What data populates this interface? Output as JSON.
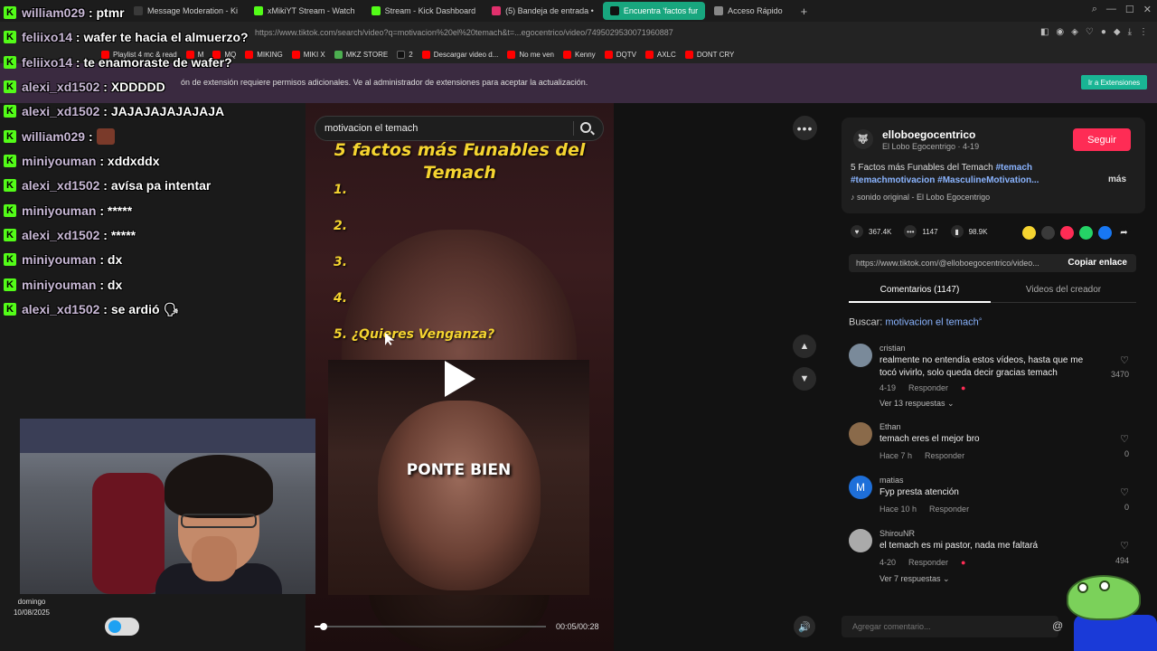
{
  "browser": {
    "tabs": [
      {
        "label": "Message Moderation - Ki",
        "color": "#3a3a3a"
      },
      {
        "label": "xMikiYT Stream - Watch",
        "color": "#53fc18"
      },
      {
        "label": "Stream - Kick Dashboard",
        "color": "#53fc18"
      },
      {
        "label": "(5) Bandeja de entrada •",
        "color": "#e1306c"
      },
      {
        "label": "Encuentra 'factos fur",
        "color": "#111111"
      },
      {
        "label": "Acceso Rápido",
        "color": "#888888"
      }
    ],
    "new_tab": "+",
    "url": "https://www.tiktok.com/search/video?q=motivacion%20el%20temach&t=...egocentrico/video/7495029530071960887",
    "bookmarks": [
      {
        "label": "Playlist 4 mc & read",
        "color": "#ff0000"
      },
      {
        "label": "M",
        "color": "#ff0000"
      },
      {
        "label": "MQ",
        "color": "#ff0000"
      },
      {
        "label": "MIKING",
        "color": "#ff0000"
      },
      {
        "label": "MIKI X",
        "color": "#ff0000"
      },
      {
        "label": "MKZ STORE",
        "color": "#4caf50"
      },
      {
        "label": "2",
        "color": "#111111"
      },
      {
        "label": "Descargar video d...",
        "color": "#ff0000"
      },
      {
        "label": "No me ven",
        "color": "#ff0000"
      },
      {
        "label": "Kenny",
        "color": "#ff0000"
      },
      {
        "label": "DQTV",
        "color": "#ff0000"
      },
      {
        "label": "AXLC",
        "color": "#ff0000"
      },
      {
        "label": "DONT CRY",
        "color": "#ff0000"
      }
    ]
  },
  "banner": {
    "text": "ón de extensión requiere permisos adicionales. Ve al administrador de extensiones para aceptar la actualización.",
    "button": "Ir a Extensiones"
  },
  "chat": [
    {
      "user": "william029",
      "msg": ": ptmr"
    },
    {
      "user": "feliixo14",
      "msg": ": wafer te hacia el almuerzo?"
    },
    {
      "user": "feliixo14",
      "msg": ": te enamoraste de wafer?"
    },
    {
      "user": "alexi_xd1502",
      "msg": ": XDDDDD"
    },
    {
      "user": "alexi_xd1502",
      "msg": ": JAJAJAJAJAJAJA"
    },
    {
      "user": "william029",
      "msg": ":"
    },
    {
      "user": "miniyouman",
      "msg": ": xddxddx"
    },
    {
      "user": "alexi_xd1502",
      "msg": ": avísa pa intentar"
    },
    {
      "user": "miniyouman",
      "msg": ": *****"
    },
    {
      "user": "alexi_xd1502",
      "msg": ": *****"
    },
    {
      "user": "miniyouman",
      "msg": ": dx"
    },
    {
      "user": "miniyouman",
      "msg": ": dx"
    },
    {
      "user": "alexi_xd1502",
      "msg": ": se ardió 🗣"
    }
  ],
  "taskbar": {
    "day": "domingo",
    "date": "10/08/2025"
  },
  "video": {
    "search_value": "motivacion el temach",
    "title": "5 factos más Funables del Temach",
    "list": [
      "1.",
      "2.",
      "3.",
      "4.",
      "5. ¿Quieres Venganza?"
    ],
    "overlay_text": "PONTE BIEN",
    "timecode": "00:05/00:28",
    "progress": 0.04
  },
  "creator": {
    "handle": "elloboegocentrico",
    "subtitle": "El Lobo Egocentrigo · 4-19",
    "follow": "Seguir",
    "desc_text": "5 Factos más Funables del Temach ",
    "tags": [
      "#temach",
      "#temachmotivacion",
      "#MasculineMotivation..."
    ],
    "more": "más",
    "sound": "sonido original - El Lobo Egocentrigo",
    "likes": "367.4K",
    "comments": "1147",
    "saves": "98.9K",
    "link": "https://www.tiktok.com/@elloboegocentrico/video...",
    "copy": "Copiar enlace"
  },
  "tabs": {
    "comments": "Comentarios (1147)",
    "videos": "Videos del creador"
  },
  "buscar": {
    "label": "Buscar: ",
    "term": "motivacion el temach"
  },
  "comments": [
    {
      "name": "cristian",
      "text": "realmente no entendía estos vídeos, hasta que me tocó vivirlo, solo queda decir gracias temach",
      "date": "4-19",
      "reply": "Responder",
      "likes": "3470",
      "replies": "Ver 13 respuestas ⌄",
      "avatar_color": "#7a8a9a"
    },
    {
      "name": "Ethan",
      "text": "temach eres el mejor bro",
      "date": "Hace 7 h",
      "reply": "Responder",
      "likes": "0",
      "replies": "",
      "avatar_color": "#8a6a4a"
    },
    {
      "name": "matias",
      "text": "Fyp presta atención",
      "date": "Hace 10 h",
      "reply": "Responder",
      "likes": "0",
      "replies": "",
      "avatar_color": "#1e6fd9"
    },
    {
      "name": "ShirouNR",
      "text": "el temach es mi pastor, nada me faltará",
      "date": "4-20",
      "reply": "Responder",
      "likes": "494",
      "replies": "Ver 7 respuestas ⌄",
      "avatar_color": "#aaaaaa"
    }
  ],
  "add_comment": {
    "placeholder": "Agregar comentario..."
  }
}
